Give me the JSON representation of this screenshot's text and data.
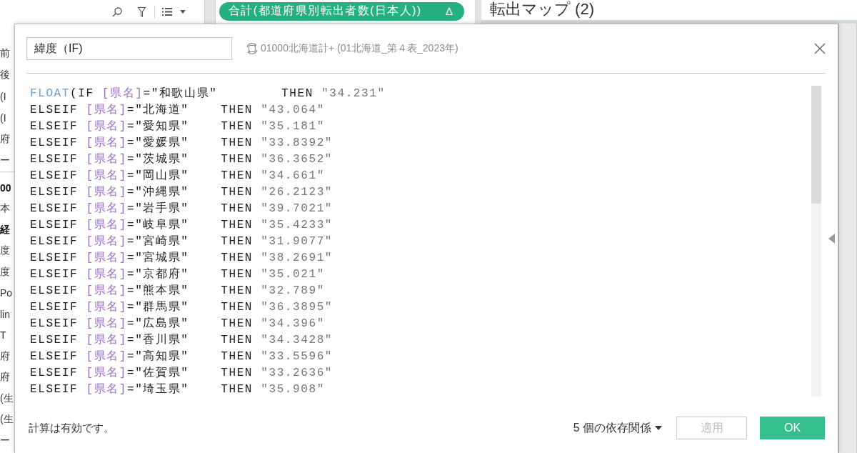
{
  "shelf": {
    "pill": {
      "label": "合計(都道府県別転出者数(日本人))",
      "marker": "Δ"
    }
  },
  "sheet": {
    "title": "転出マップ (2)"
  },
  "sidebar": {
    "sections": [
      {
        "items": [
          {
            "text": "前",
            "kind": "field"
          },
          {
            "text": "後",
            "kind": "field"
          },
          {
            "text": "(I",
            "kind": "field"
          },
          {
            "text": "(I",
            "kind": "field"
          },
          {
            "text": "府",
            "kind": "field"
          },
          {
            "text": "ー",
            "kind": "field"
          }
        ]
      },
      {
        "items": [
          {
            "text": "00",
            "kind": "heading"
          },
          {
            "text": "本",
            "kind": "field"
          },
          {
            "text": "経",
            "kind": "heading"
          },
          {
            "text": "度",
            "kind": "field"
          },
          {
            "text": "度",
            "kind": "field"
          },
          {
            "text": "Po",
            "kind": "field"
          },
          {
            "text": "lin",
            "kind": "field"
          },
          {
            "text": "T",
            "kind": "field"
          },
          {
            "text": "府",
            "kind": "field"
          },
          {
            "text": "府",
            "kind": "field"
          },
          {
            "text": "(生",
            "kind": "field"
          },
          {
            "text": "(生",
            "kind": "field"
          },
          {
            "text": "ー",
            "kind": "field"
          }
        ]
      }
    ]
  },
  "dialog": {
    "name_field": {
      "value": "緯度（IF)"
    },
    "data_source": "01000北海道計+ (01北海道_第４表_2023年)",
    "formula": {
      "lines": [
        {
          "tokens": [
            {
              "kind": "function",
              "text": "FLOAT"
            },
            {
              "kind": "plain",
              "text": "(IF "
            },
            {
              "kind": "field",
              "text": "[県名]"
            },
            {
              "kind": "plain",
              "text": "=\"和歌山県\"        THEN "
            },
            {
              "kind": "string",
              "text": "\"34.231\""
            }
          ]
        },
        {
          "tokens": [
            {
              "kind": "plain",
              "text": "ELSEIF "
            },
            {
              "kind": "field",
              "text": "[県名]"
            },
            {
              "kind": "plain",
              "text": "=\"北海道\"    THEN "
            },
            {
              "kind": "string",
              "text": "\"43.064\""
            }
          ]
        },
        {
          "tokens": [
            {
              "kind": "plain",
              "text": "ELSEIF "
            },
            {
              "kind": "field",
              "text": "[県名]"
            },
            {
              "kind": "plain",
              "text": "=\"愛知県\"    THEN "
            },
            {
              "kind": "string",
              "text": "\"35.181\""
            }
          ]
        },
        {
          "tokens": [
            {
              "kind": "plain",
              "text": "ELSEIF "
            },
            {
              "kind": "field",
              "text": "[県名]"
            },
            {
              "kind": "plain",
              "text": "=\"愛媛県\"    THEN "
            },
            {
              "kind": "string",
              "text": "\"33.8392\""
            }
          ]
        },
        {
          "tokens": [
            {
              "kind": "plain",
              "text": "ELSEIF "
            },
            {
              "kind": "field",
              "text": "[県名]"
            },
            {
              "kind": "plain",
              "text": "=\"茨城県\"    THEN "
            },
            {
              "kind": "string",
              "text": "\"36.3652\""
            }
          ]
        },
        {
          "tokens": [
            {
              "kind": "plain",
              "text": "ELSEIF "
            },
            {
              "kind": "field",
              "text": "[県名]"
            },
            {
              "kind": "plain",
              "text": "=\"岡山県\"    THEN "
            },
            {
              "kind": "string",
              "text": "\"34.661\""
            }
          ]
        },
        {
          "tokens": [
            {
              "kind": "plain",
              "text": "ELSEIF "
            },
            {
              "kind": "field",
              "text": "[県名]"
            },
            {
              "kind": "plain",
              "text": "=\"沖縄県\"    THEN "
            },
            {
              "kind": "string",
              "text": "\"26.2123\""
            }
          ]
        },
        {
          "tokens": [
            {
              "kind": "plain",
              "text": "ELSEIF "
            },
            {
              "kind": "field",
              "text": "[県名]"
            },
            {
              "kind": "plain",
              "text": "=\"岩手県\"    THEN "
            },
            {
              "kind": "string",
              "text": "\"39.7021\""
            }
          ]
        },
        {
          "tokens": [
            {
              "kind": "plain",
              "text": "ELSEIF "
            },
            {
              "kind": "field",
              "text": "[県名]"
            },
            {
              "kind": "plain",
              "text": "=\"岐阜県\"    THEN "
            },
            {
              "kind": "string",
              "text": "\"35.4233\""
            }
          ]
        },
        {
          "tokens": [
            {
              "kind": "plain",
              "text": "ELSEIF "
            },
            {
              "kind": "field",
              "text": "[県名]"
            },
            {
              "kind": "plain",
              "text": "=\"宮崎県\"    THEN "
            },
            {
              "kind": "string",
              "text": "\"31.9077\""
            }
          ]
        },
        {
          "tokens": [
            {
              "kind": "plain",
              "text": "ELSEIF "
            },
            {
              "kind": "field",
              "text": "[県名]"
            },
            {
              "kind": "plain",
              "text": "=\"宮城県\"    THEN "
            },
            {
              "kind": "string",
              "text": "\"38.2691\""
            }
          ]
        },
        {
          "tokens": [
            {
              "kind": "plain",
              "text": "ELSEIF "
            },
            {
              "kind": "field",
              "text": "[県名]"
            },
            {
              "kind": "plain",
              "text": "=\"京都府\"    THEN "
            },
            {
              "kind": "string",
              "text": "\"35.021\""
            }
          ]
        },
        {
          "tokens": [
            {
              "kind": "plain",
              "text": "ELSEIF "
            },
            {
              "kind": "field",
              "text": "[県名]"
            },
            {
              "kind": "plain",
              "text": "=\"熊本県\"    THEN "
            },
            {
              "kind": "string",
              "text": "\"32.789\""
            }
          ]
        },
        {
          "tokens": [
            {
              "kind": "plain",
              "text": "ELSEIF "
            },
            {
              "kind": "field",
              "text": "[県名]"
            },
            {
              "kind": "plain",
              "text": "=\"群馬県\"    THEN "
            },
            {
              "kind": "string",
              "text": "\"36.3895\""
            }
          ]
        },
        {
          "tokens": [
            {
              "kind": "plain",
              "text": "ELSEIF "
            },
            {
              "kind": "field",
              "text": "[県名]"
            },
            {
              "kind": "plain",
              "text": "=\"広島県\"    THEN "
            },
            {
              "kind": "string",
              "text": "\"34.396\""
            }
          ]
        },
        {
          "tokens": [
            {
              "kind": "plain",
              "text": "ELSEIF "
            },
            {
              "kind": "field",
              "text": "[県名]"
            },
            {
              "kind": "plain",
              "text": "=\"香川県\"    THEN "
            },
            {
              "kind": "string",
              "text": "\"34.3428\""
            }
          ]
        },
        {
          "tokens": [
            {
              "kind": "plain",
              "text": "ELSEIF "
            },
            {
              "kind": "field",
              "text": "[県名]"
            },
            {
              "kind": "plain",
              "text": "=\"高知県\"    THEN "
            },
            {
              "kind": "string",
              "text": "\"33.5596\""
            }
          ]
        },
        {
          "tokens": [
            {
              "kind": "plain",
              "text": "ELSEIF "
            },
            {
              "kind": "field",
              "text": "[県名]"
            },
            {
              "kind": "plain",
              "text": "=\"佐賀県\"    THEN "
            },
            {
              "kind": "string",
              "text": "\"33.2636\""
            }
          ]
        },
        {
          "tokens": [
            {
              "kind": "plain",
              "text": "ELSEIF "
            },
            {
              "kind": "field",
              "text": "[県名]"
            },
            {
              "kind": "plain",
              "text": "=\"埼玉県\"    THEN "
            },
            {
              "kind": "string",
              "text": "\"35.908\""
            }
          ]
        }
      ]
    },
    "status": "計算は有効です。",
    "dependencies": "5 個の依存関係",
    "buttons": [
      {
        "label": "適用",
        "kind": "secondary",
        "disabled": true
      },
      {
        "label": "OK",
        "kind": "primary",
        "disabled": false
      }
    ]
  }
}
